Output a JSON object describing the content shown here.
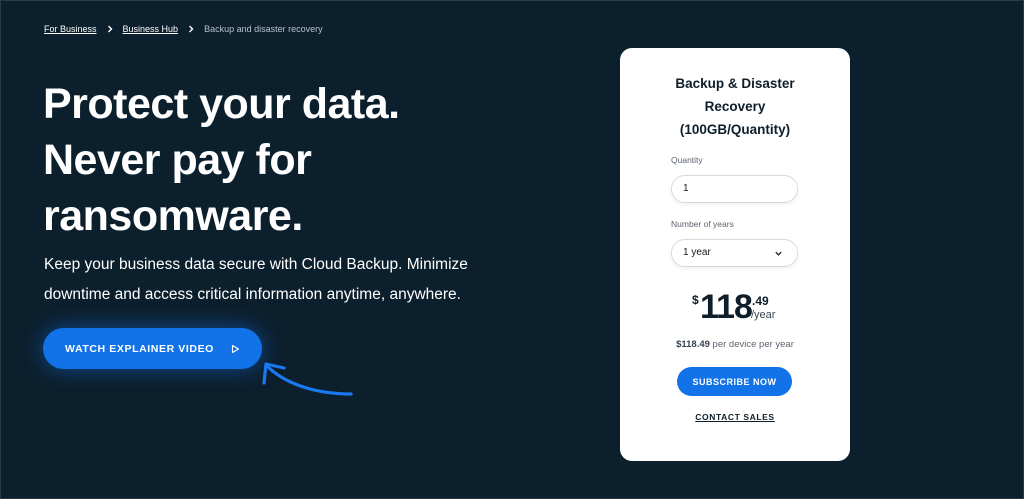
{
  "breadcrumb": {
    "items": [
      "For Business",
      "Business Hub"
    ],
    "current": "Backup and disaster recovery"
  },
  "hero": {
    "title_lines": [
      "Protect your data.",
      "Never pay for",
      "ransomware."
    ],
    "subtitle_lines": [
      "Keep your business data secure with Cloud Backup. Minimize",
      "downtime and access critical information anytime, anywhere."
    ],
    "watch_button_label": "WATCH EXPLAINER VIDEO"
  },
  "card": {
    "title_lines": [
      "Backup & Disaster",
      "Recovery",
      "(100GB/Quantity)"
    ],
    "quantity_label": "Quantity",
    "quantity_value": "1",
    "years_label": "Number of years",
    "years_value": "1 year",
    "price_currency": "$",
    "price_whole": "118",
    "price_cents": ".49",
    "price_period": "/year",
    "per_device_amount": "$118.49",
    "per_device_text": " per device per year",
    "subscribe_label": "SUBSCRIBE NOW",
    "contact_label": "CONTACT SALES"
  },
  "icons": {
    "breadcrumb_separator": "chevron-right-icon",
    "play": "play-icon",
    "dropdown": "chevron-down-icon",
    "arrow": "curved-arrow-icon"
  },
  "colors": {
    "background": "#0c1f2d",
    "accent": "#1272e8",
    "card": "#ffffff"
  }
}
